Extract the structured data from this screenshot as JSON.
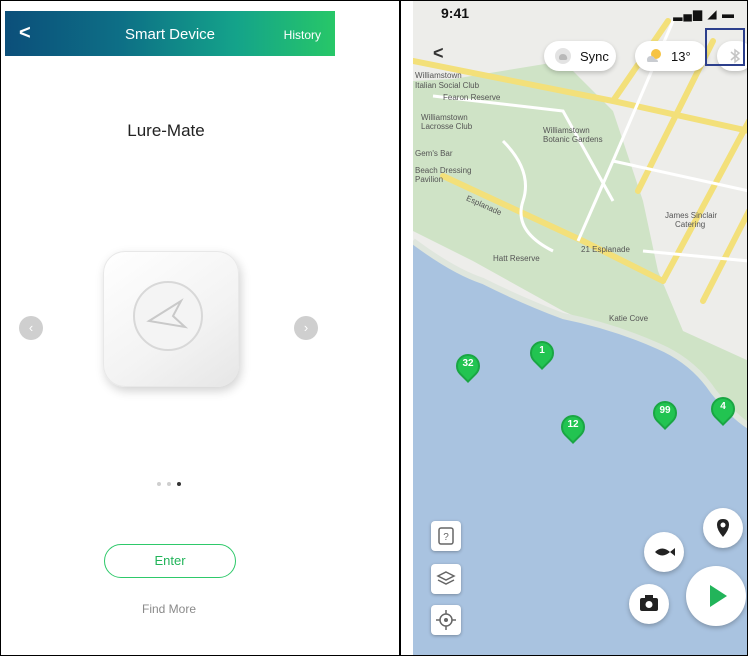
{
  "left": {
    "header": {
      "back": "<",
      "title": "Smart Device",
      "history": "History"
    },
    "device_name": "Lure-Mate",
    "carousel": {
      "prev": "‹",
      "next": "›",
      "dots": 3,
      "active_dot": 3
    },
    "enter_label": "Enter",
    "find_more_label": "Find More"
  },
  "right": {
    "status": {
      "time": "9:41",
      "icons": "▂▄▆ ◢ ▬"
    },
    "top": {
      "back": "<",
      "sync_label": "Sync",
      "temperature": "13°"
    },
    "map_labels": [
      "Williamstown",
      "Italian Social Club",
      "Fearon Reserve",
      "Williamstown",
      "Lacrosse Club",
      "Williamstown",
      "Botanic Gardens",
      "Gem's Bar",
      "Beach Dressing",
      "Pavilion",
      "Esplanade",
      "James Sinclair",
      "Catering",
      "21 Esplanade",
      "Hatt Reserve",
      "Katie Cove"
    ],
    "markers": [
      "32",
      "1",
      "12",
      "99",
      "4"
    ],
    "colors": {
      "water": "#a9c3e0",
      "park": "#cfe3c6",
      "road": "#f3e07a",
      "marker": "#22c451"
    }
  }
}
